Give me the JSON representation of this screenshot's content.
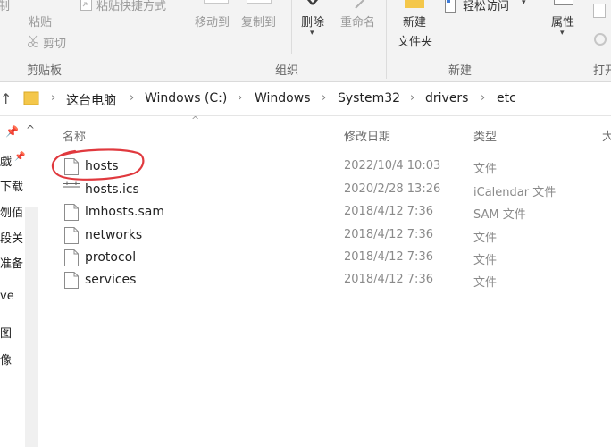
{
  "ribbon": {
    "clipboard": {
      "cut_partial": "制",
      "paste": "粘贴",
      "paste_shortcut": "粘贴快捷方式",
      "cut": "剪切",
      "group_label": "剪贴板"
    },
    "organize": {
      "move_to": "移动到",
      "copy_to": "复制到",
      "delete": "删除",
      "rename": "重命名",
      "group_label": "组织"
    },
    "new": {
      "new_folder_line1": "新建",
      "new_folder_line2": "文件夹",
      "easy_access": "轻松访问",
      "group_label": "新建"
    },
    "open": {
      "properties": "属性",
      "group_label": "打开"
    }
  },
  "address": {
    "crumbs": [
      "这台电脑",
      "Windows (C:)",
      "Windows",
      "System32",
      "drivers",
      "etc"
    ]
  },
  "nav": {
    "items": [
      "戯",
      "下载",
      "刎佰",
      "段关",
      "准备",
      "ve",
      "图",
      "像"
    ]
  },
  "columns": {
    "name": "名称",
    "date": "修改日期",
    "type": "类型",
    "size_partial": "大"
  },
  "files": [
    {
      "name": "hosts",
      "date": "2022/10/4 10:03",
      "type": "文件",
      "icon": "file-icon",
      "highlighted": true
    },
    {
      "name": "hosts.ics",
      "date": "2020/2/28 13:26",
      "type": "iCalendar 文件",
      "icon": "calendar-file-icon",
      "highlighted": false
    },
    {
      "name": "lmhosts.sam",
      "date": "2018/4/12 7:36",
      "type": "SAM 文件",
      "icon": "file-icon",
      "highlighted": false
    },
    {
      "name": "networks",
      "date": "2018/4/12 7:36",
      "type": "文件",
      "icon": "file-icon",
      "highlighted": false
    },
    {
      "name": "protocol",
      "date": "2018/4/12 7:36",
      "type": "文件",
      "icon": "file-icon",
      "highlighted": false
    },
    {
      "name": "services",
      "date": "2018/4/12 7:36",
      "type": "文件",
      "icon": "file-icon",
      "highlighted": false
    }
  ],
  "colors": {
    "annotation_circle": "#e0393e",
    "folder": "#f4c74a"
  }
}
